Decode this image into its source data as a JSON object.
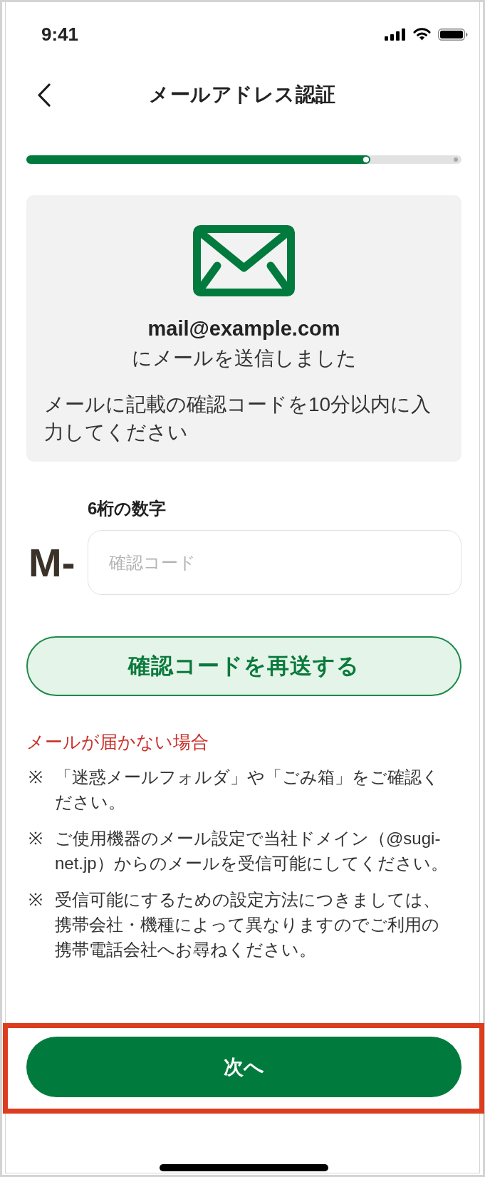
{
  "status_bar": {
    "time": "9:41"
  },
  "header": {
    "title": "メールアドレス認証"
  },
  "progress": {
    "level": 0.79
  },
  "sent_card": {
    "email": "mail@example.com",
    "sent_text": "にメールを送信しました",
    "instruction": "メールに記載の確認コードを10分以内に入力してください"
  },
  "code_field": {
    "label": "6桁の数字",
    "prefix": "M-",
    "placeholder": "確認コード"
  },
  "resend_button": {
    "label": "確認コードを再送する"
  },
  "help": {
    "title": "メールが届かない場合",
    "items": [
      {
        "mark": "※",
        "text": "「迷惑メールフォルダ」や「ごみ箱」をご確認ください。"
      },
      {
        "mark": "※",
        "text": "ご使用機器のメール設定で当社ドメイン（@sugi-net.jp）からのメールを受信可能にしてください。"
      },
      {
        "mark": "※",
        "text": "受信可能にするための設定方法につきましては、携帯会社・機種によって異なりますのでご利用の携帯電話会社へお尋ねください。"
      }
    ]
  },
  "next_button": {
    "label": "次へ",
    "highlighted": true
  }
}
